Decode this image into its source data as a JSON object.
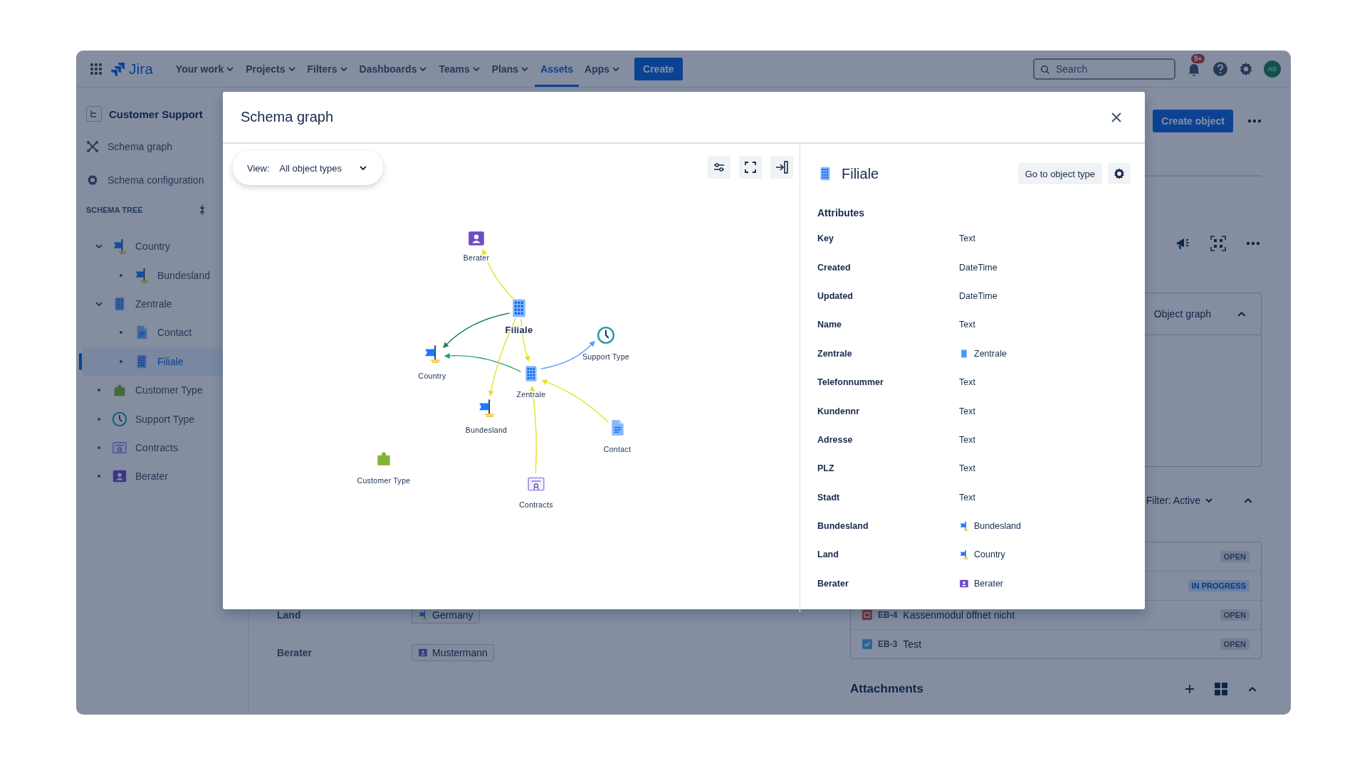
{
  "nav": {
    "logo": "Jira",
    "items": [
      {
        "label": "Your work",
        "selected": false,
        "dropdown": true
      },
      {
        "label": "Projects",
        "selected": false,
        "dropdown": true
      },
      {
        "label": "Filters",
        "selected": false,
        "dropdown": true
      },
      {
        "label": "Dashboards",
        "selected": false,
        "dropdown": true
      },
      {
        "label": "Teams",
        "selected": false,
        "dropdown": true
      },
      {
        "label": "Plans",
        "selected": false,
        "dropdown": true
      },
      {
        "label": "Assets",
        "selected": true,
        "dropdown": false
      },
      {
        "label": "Apps",
        "selected": false,
        "dropdown": true
      }
    ],
    "create": "Create",
    "search": {
      "placeholder": "Search"
    },
    "notifications": "9+",
    "avatar": "AS"
  },
  "sidebar": {
    "title": "Customer Support",
    "links": [
      {
        "label": "Schema graph",
        "kind": "graph"
      },
      {
        "label": "Schema configuration",
        "kind": "settings"
      }
    ],
    "tree_heading": "SCHEMA TREE",
    "tree": [
      {
        "label": "Country",
        "kind": "flag",
        "selected": false,
        "expanded": true,
        "children": [
          {
            "label": "Bundesland",
            "kind": "flag",
            "selected": false
          }
        ]
      },
      {
        "label": "Zentrale",
        "kind": "building",
        "selected": false,
        "expanded": true,
        "children": [
          {
            "label": "Contact",
            "kind": "document",
            "selected": false
          },
          {
            "label": "Filiale",
            "kind": "building",
            "selected": true
          }
        ]
      },
      {
        "label": "Customer Type",
        "kind": "puzzle",
        "selected": false
      },
      {
        "label": "Support Type",
        "kind": "clock",
        "selected": false
      },
      {
        "label": "Contracts",
        "kind": "certificate",
        "selected": false
      },
      {
        "label": "Berater",
        "kind": "person",
        "selected": false
      }
    ]
  },
  "page": {
    "create_object": "Create object",
    "object_graph": "Object graph",
    "filter": "Filter: Active",
    "fields": [
      {
        "label": "Land",
        "value": "Germany",
        "kind": "flag"
      },
      {
        "label": "Berater",
        "value": "Mustermann",
        "kind": "person"
      }
    ],
    "issues": [
      {
        "status": {
          "label": "OPEN",
          "kind": "todo"
        }
      },
      {
        "status": {
          "label": "IN PROGRESS",
          "kind": "inprogress"
        }
      },
      {
        "kind": "bug",
        "key": "EB-4",
        "summary": "Kassenmodul öffnet nicht",
        "status": {
          "label": "OPEN",
          "kind": "todo"
        }
      },
      {
        "kind": "task",
        "key": "EB-3",
        "summary": "Test",
        "status": {
          "label": "OPEN",
          "kind": "todo"
        }
      }
    ],
    "attachments": "Attachments"
  },
  "modal": {
    "title": "Schema graph",
    "view": {
      "label": "View:",
      "value": "All object types"
    },
    "graph": {
      "nodes": [
        {
          "label": "Berater",
          "kind": "person",
          "selected": false
        },
        {
          "label": "Filiale",
          "kind": "building",
          "selected": true
        },
        {
          "label": "Country",
          "kind": "flag",
          "selected": false
        },
        {
          "label": "Zentrale",
          "kind": "building",
          "selected": false
        },
        {
          "label": "Support Type",
          "kind": "clock",
          "selected": false
        },
        {
          "label": "Bundesland",
          "kind": "flag",
          "selected": false
        },
        {
          "label": "Contact",
          "kind": "document",
          "selected": false
        },
        {
          "label": "Customer Type",
          "kind": "puzzle",
          "selected": false
        },
        {
          "label": "Contracts",
          "kind": "certificate",
          "selected": false
        }
      ]
    },
    "details": {
      "title": "Filiale",
      "kind": "building",
      "button": "Go to object type",
      "heading": "Attributes",
      "attributes": [
        {
          "name": "Key",
          "value": "Text",
          "kind": "type"
        },
        {
          "name": "Created",
          "value": "DateTime",
          "kind": "type"
        },
        {
          "name": "Updated",
          "value": "DateTime",
          "kind": "type"
        },
        {
          "name": "Name",
          "value": "Text",
          "kind": "type"
        },
        {
          "name": "Zentrale",
          "value": "Zentrale",
          "kind": "building"
        },
        {
          "name": "Telefonnummer",
          "value": "Text",
          "kind": "type"
        },
        {
          "name": "Kundennr",
          "value": "Text",
          "kind": "type"
        },
        {
          "name": "Adresse",
          "value": "Text",
          "kind": "type"
        },
        {
          "name": "PLZ",
          "value": "Text",
          "kind": "type"
        },
        {
          "name": "Stadt",
          "value": "Text",
          "kind": "type"
        },
        {
          "name": "Bundesland",
          "value": "Bundesland",
          "kind": "flag"
        },
        {
          "name": "Land",
          "value": "Country",
          "kind": "flag"
        },
        {
          "name": "Berater",
          "value": "Berater",
          "kind": "person"
        }
      ]
    }
  }
}
